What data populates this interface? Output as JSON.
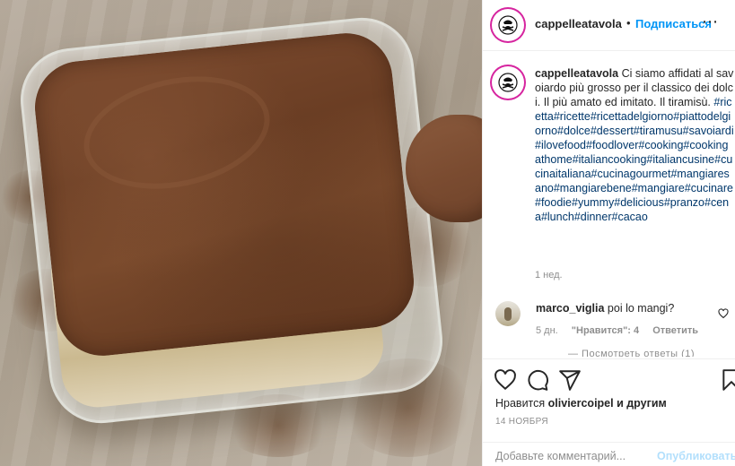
{
  "post": {
    "username": "cappelleatavola",
    "follow_separator": "•",
    "follow_label": "Подписаться",
    "more_label": "⋯"
  },
  "caption": {
    "username": "cappelleatavola",
    "text": "Ci siamo affidati al savoiardo più grosso per il classico dei dolci. Il più amato ed imitato. Il tiramisù.",
    "hashtags": "#ricetta#ricette#ricettadelgiorno#piattodelgiorno#dolce#dessert#tiramusu#savoiardi#ilovefood#foodlover#cooking#cookingathome#italiancooking#italiancusine#cucinaitaliana#cucinagourmet#mangiaresano#mangiarebene#mangiare#cucinare#foodie#yummy#delicious#pranzo#cena#lunch#dinner#cacao",
    "time": "1 нед."
  },
  "comment": {
    "username": "marco_viglia",
    "text": "poi lo mangi?",
    "time": "5 дн.",
    "likes": "\"Нравится\": 4",
    "reply": "Ответить"
  },
  "cutoff_text": "— Посмотреть ответы (1)",
  "actions": {
    "icons": [
      "heart-icon",
      "comment-icon",
      "share-icon",
      "bookmark-icon"
    ]
  },
  "likes": {
    "prefix": "Нравится",
    "user": "oliviercoipel",
    "suffix": "и другим"
  },
  "date": "14 НОЯБРЯ",
  "add_comment": {
    "placeholder": "Добавьте комментарий...",
    "publish_label": "Опубликовать"
  },
  "colors": {
    "link": "#0095f6",
    "hashtag": "#00376b",
    "muted": "#8e8e8e",
    "avatar_ring": "#d6249f"
  }
}
